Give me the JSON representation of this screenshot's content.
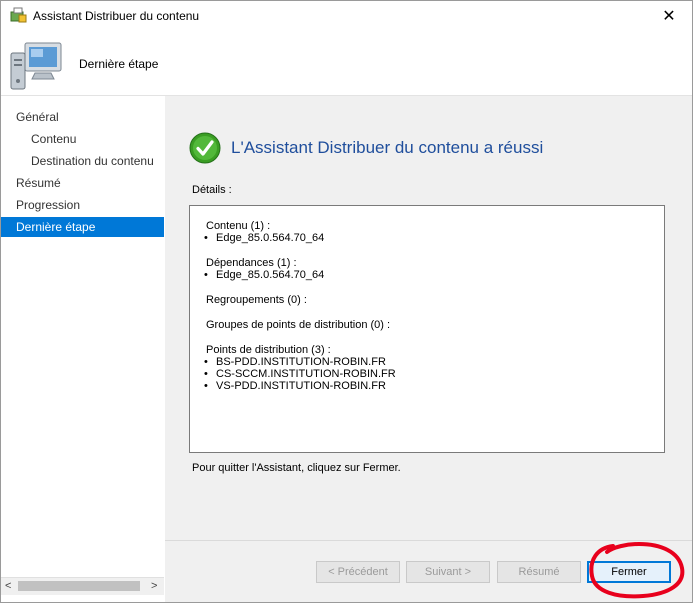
{
  "window": {
    "title": "Assistant Distribuer du contenu",
    "close_glyph": "✕"
  },
  "header": {
    "title": "Dernière étape",
    "icon": "computer-icon"
  },
  "nav": {
    "items": [
      {
        "label": "Général",
        "indent": false,
        "selected": false
      },
      {
        "label": "Contenu",
        "indent": true,
        "selected": false
      },
      {
        "label": "Destination du contenu",
        "indent": true,
        "selected": false
      },
      {
        "label": "Résumé",
        "indent": false,
        "selected": false
      },
      {
        "label": "Progression",
        "indent": false,
        "selected": false
      },
      {
        "label": "Dernière étape",
        "indent": false,
        "selected": true
      }
    ],
    "scroll_left": "<",
    "scroll_right": ">"
  },
  "main": {
    "success_text": "L'Assistant Distribuer du contenu a réussi",
    "details_label": "Détails :",
    "details": {
      "contenu_label": "Contenu (1) :",
      "contenu_items": [
        "Edge_85.0.564.70_64"
      ],
      "dependances_label": "Dépendances (1) :",
      "dependances_items": [
        "Edge_85.0.564.70_64"
      ],
      "regroupements_label": "Regroupements (0) :",
      "groupes_label": "Groupes de points de distribution (0) :",
      "points_label": "Points de distribution (3) :",
      "points_items": [
        "BS-PDD.INSTITUTION-ROBIN.FR",
        "CS-SCCM.INSTITUTION-ROBIN.FR",
        "VS-PDD.INSTITUTION-ROBIN.FR"
      ]
    },
    "quit_text": "Pour quitter l'Assistant, cliquez sur Fermer."
  },
  "footer": {
    "precedent": "< Précédent",
    "suivant": "Suivant >",
    "resume": "Résumé",
    "fermer": "Fermer"
  },
  "colors": {
    "accent": "#0078d7",
    "success_title": "#1f4e9c",
    "annotation": "#e8001c"
  }
}
